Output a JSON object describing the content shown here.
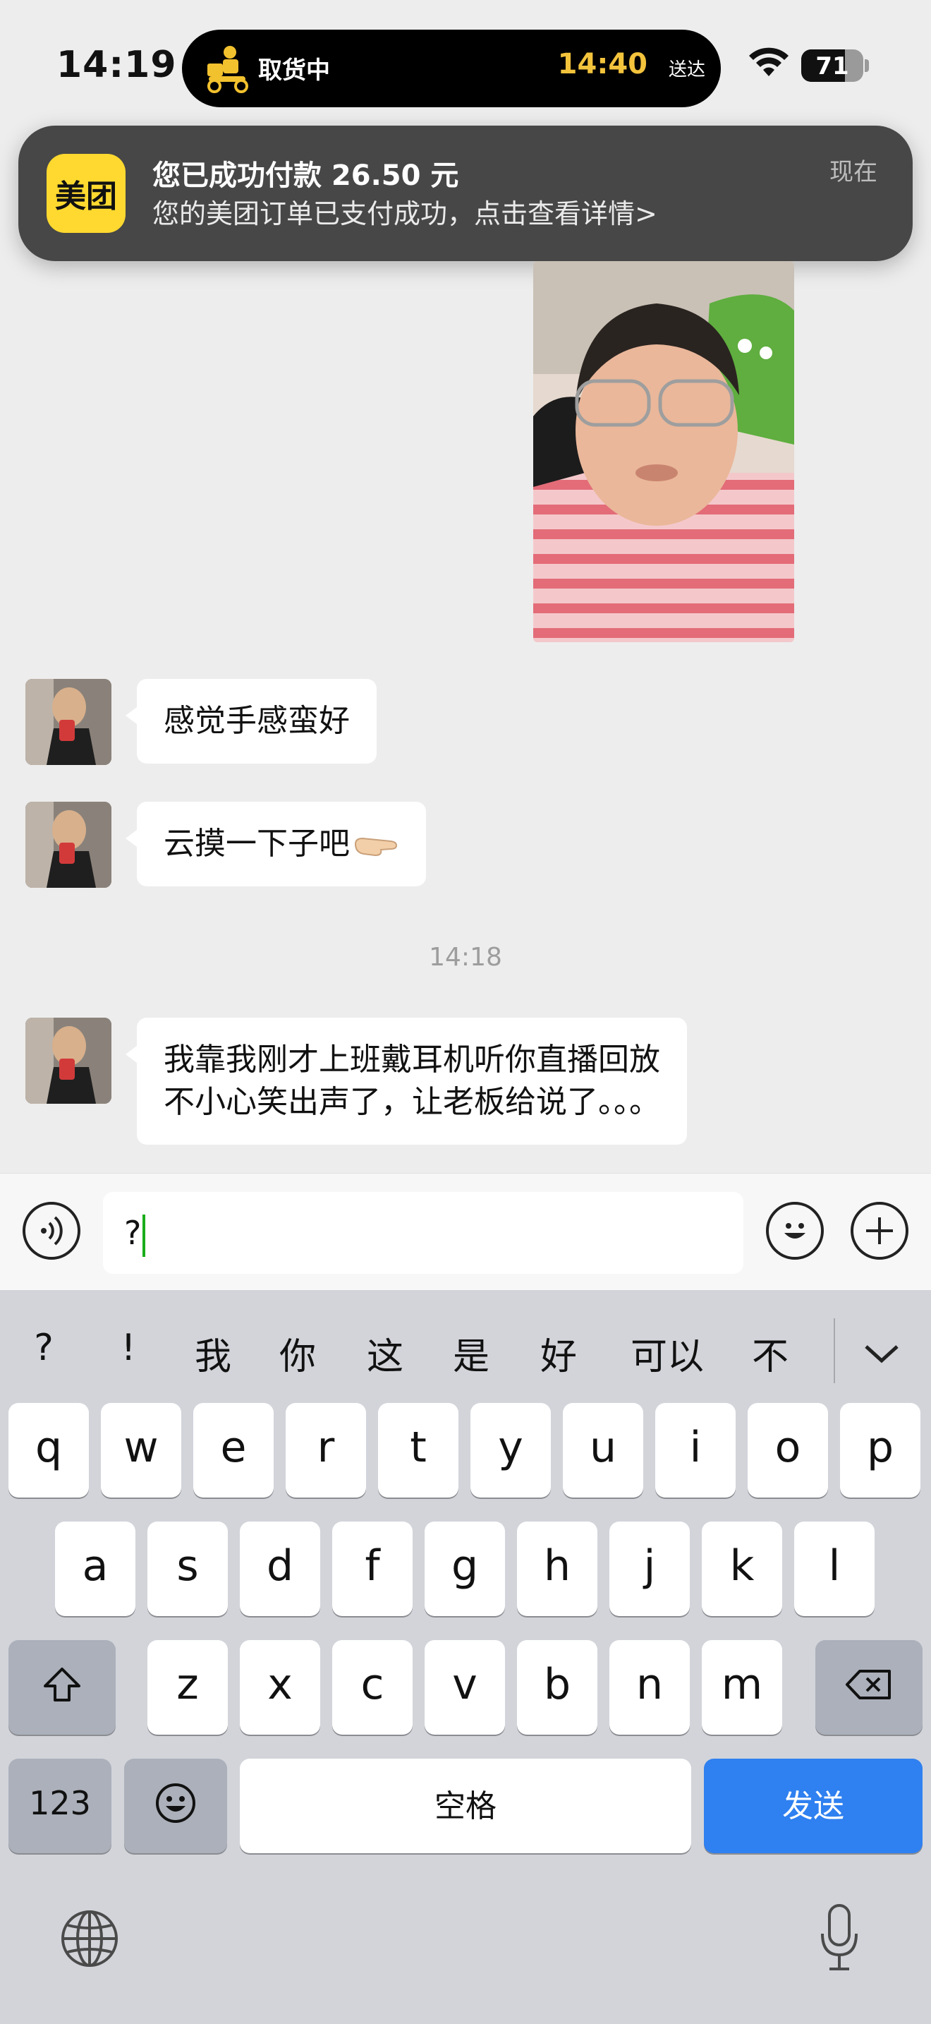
{
  "status_bar": {
    "time": "14:19",
    "live_activity_status": "取货中",
    "live_activity_time": "14:40",
    "live_activity_suffix": "送达",
    "battery": "71"
  },
  "notification": {
    "app_icon_text": "美团",
    "title": "您已成功付款 26.50 元",
    "body": "您的美团订单已支付成功，点击查看详情>",
    "time": "现在"
  },
  "messages": [
    {
      "text": "感觉手感蛮好"
    },
    {
      "text": "云摸一下子吧"
    },
    {
      "line1": "我靠我刚才上班戴耳机听你直播回放",
      "line2": "不小心笑出声了，让老板给说了。。。"
    }
  ],
  "timestamp": "14:18",
  "input": {
    "value": "?"
  },
  "candidates": [
    "?",
    "!",
    "我",
    "你",
    "这",
    "是",
    "好",
    "可以",
    "不"
  ],
  "keyboard": {
    "row1": [
      "q",
      "w",
      "e",
      "r",
      "t",
      "y",
      "u",
      "i",
      "o",
      "p"
    ],
    "row2": [
      "a",
      "s",
      "d",
      "f",
      "g",
      "h",
      "j",
      "k",
      "l"
    ],
    "row3": [
      "z",
      "x",
      "c",
      "v",
      "b",
      "n",
      "m"
    ],
    "numbers_label": "123",
    "space_label": "空格",
    "send_label": "发送"
  },
  "colors": {
    "accent_send": "#2f80f0",
    "meituan_yellow": "#ffd92f",
    "eta_yellow": "#f3c33c",
    "cursor_green": "#1aad19"
  }
}
